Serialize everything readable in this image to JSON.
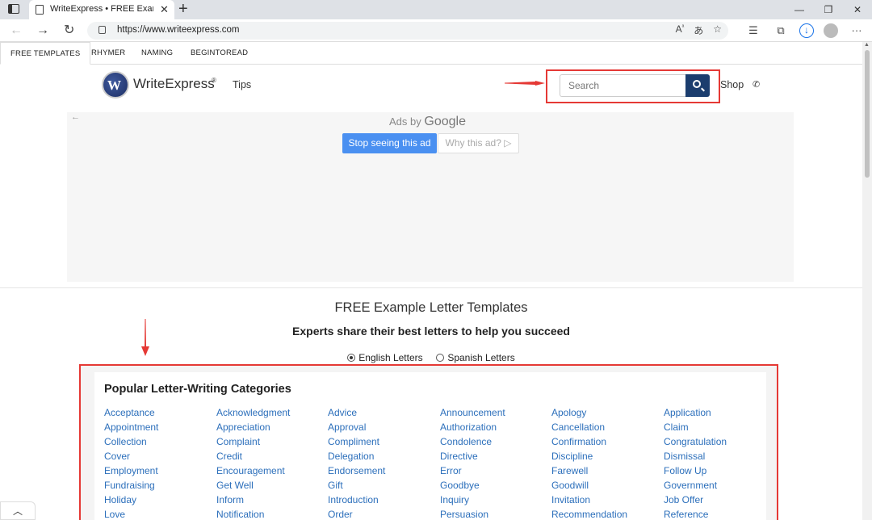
{
  "browser": {
    "tab_title": "WriteExpress • FREE Example Lett",
    "url": "https://www.writeexpress.com",
    "tab_close": "✕",
    "new_tab": "+",
    "window_buttons": [
      "—",
      "❐",
      "✕"
    ]
  },
  "sitenav": {
    "items": [
      "FREE TEMPLATES",
      "RHYMER",
      "NAMING",
      "BEGINTOREAD"
    ]
  },
  "header": {
    "logo": "WriteExpress",
    "logo_reg": "®",
    "tips": "Tips",
    "search_placeholder": "Search",
    "shop": "Shop"
  },
  "ad": {
    "ads_by": "Ads by",
    "google": "Google",
    "stop": "Stop seeing this ad",
    "why": "Why this ad? ▷"
  },
  "main": {
    "title": "FREE Example Letter Templates",
    "subtitle": "Experts share their best letters to help you succeed",
    "radio_english": "English Letters",
    "radio_spanish": "Spanish Letters"
  },
  "categories": {
    "heading": "Popular Letter-Writing Categories",
    "columns": [
      [
        "Acceptance",
        "Appointment",
        "Collection",
        "Cover",
        "Employment",
        "Fundraising",
        "Holiday",
        "Love"
      ],
      [
        "Acknowledgment",
        "Appreciation",
        "Complaint",
        "Credit",
        "Encouragement",
        "Get Well",
        "Inform",
        "Notification"
      ],
      [
        "Advice",
        "Approval",
        "Compliment",
        "Delegation",
        "Endorsement",
        "Gift",
        "Introduction",
        "Order"
      ],
      [
        "Announcement",
        "Authorization",
        "Condolence",
        "Directive",
        "Error",
        "Goodbye",
        "Inquiry",
        "Persuasion"
      ],
      [
        "Apology",
        "Cancellation",
        "Confirmation",
        "Discipline",
        "Farewell",
        "Goodwill",
        "Invitation",
        "Recommendation"
      ],
      [
        "Application",
        "Claim",
        "Congratulation",
        "Dismissal",
        "Follow Up",
        "Government",
        "Job Offer",
        "Reference"
      ]
    ]
  },
  "colors": {
    "link": "#2c6fbb",
    "search_button": "#1b3d6e",
    "annotation": "#e53935",
    "ad_button": "#4a90f1"
  }
}
